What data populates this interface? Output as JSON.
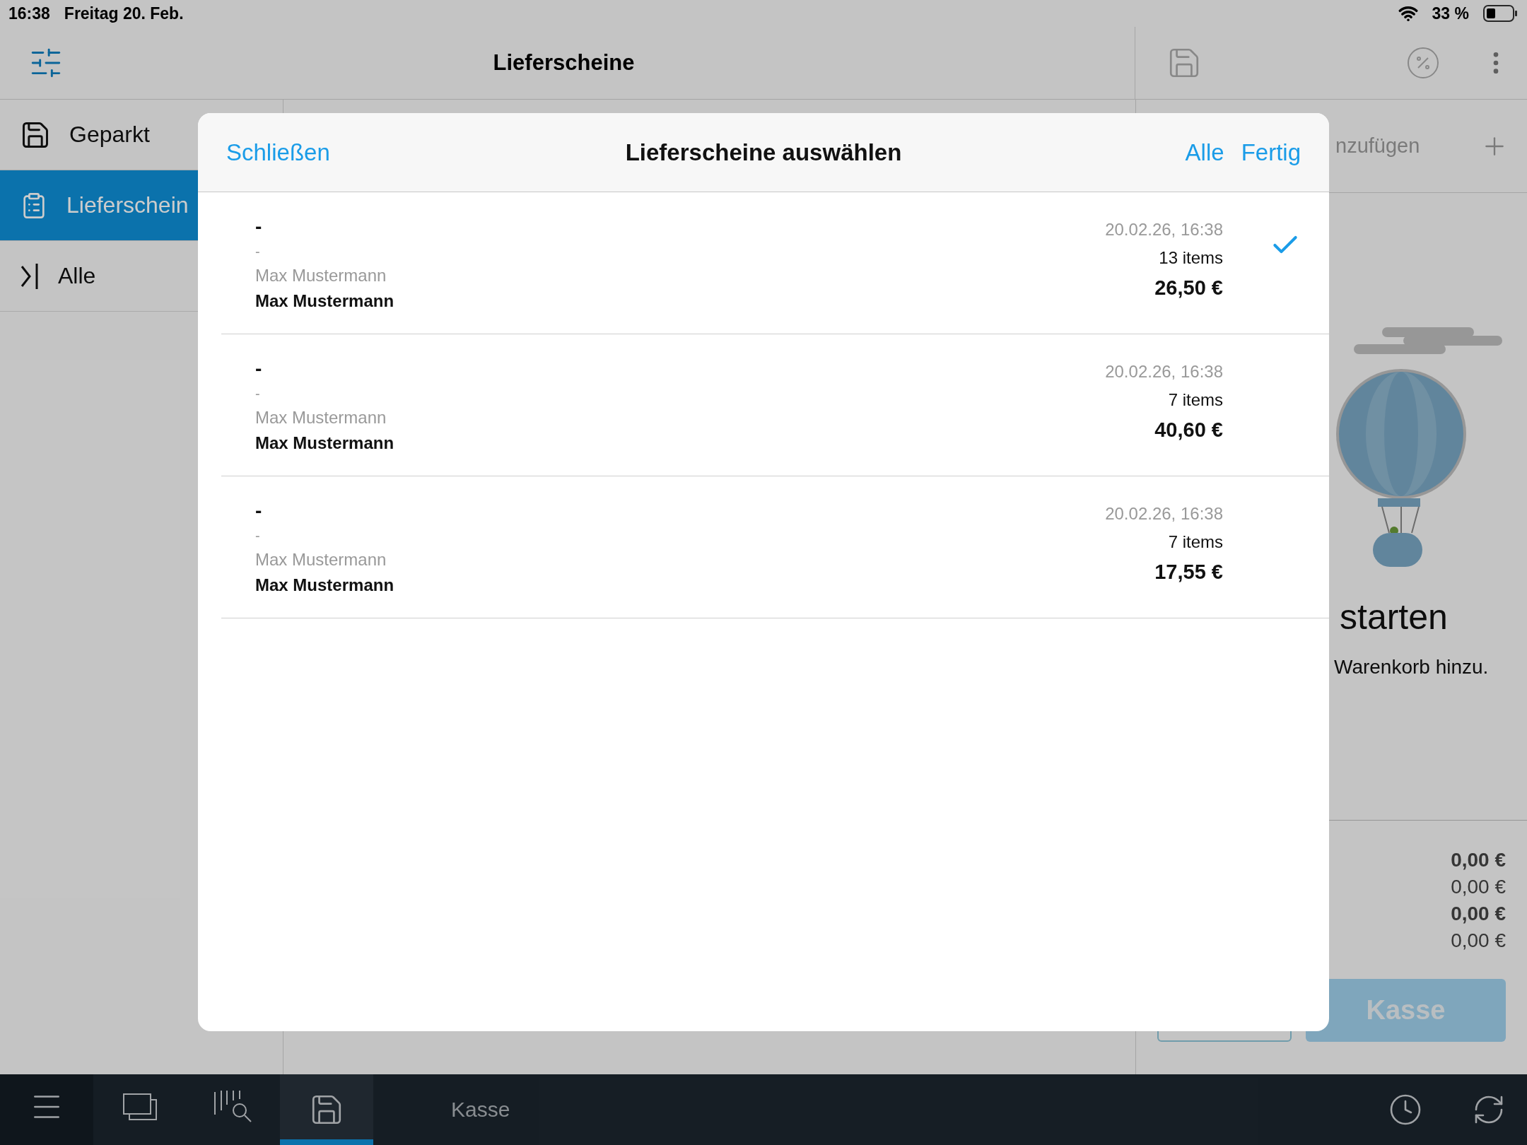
{
  "status_bar": {
    "time": "16:38",
    "date": "Freitag 20. Feb.",
    "battery": "33 %"
  },
  "header": {
    "title": "Lieferscheine"
  },
  "sidebar": {
    "items": [
      {
        "label": "Geparkt",
        "kind": "parked",
        "selected": false
      },
      {
        "label": "Lieferschein",
        "kind": "delivery",
        "selected": true
      },
      {
        "label": "Alle",
        "kind": "all",
        "selected": false
      }
    ]
  },
  "right_panel": {
    "customer_label": "nzufügen",
    "empty_title": "starten",
    "empty_text": "Warenkorb hinzu.",
    "totals": [
      {
        "amount": "0,00 €",
        "bold": true
      },
      {
        "amount": "0,00 €",
        "bold": false
      },
      {
        "amount": "0,00 €",
        "bold": true
      },
      {
        "amount": "0,00 €",
        "bold": false
      }
    ],
    "checkout_button": "Kasse"
  },
  "dialog": {
    "close": "Schließen",
    "title": "Lieferscheine auswählen",
    "select_all": "Alle",
    "done": "Fertig",
    "rows": [
      {
        "title": "-",
        "subtitle": "-",
        "name": "Max Mustermann",
        "customer": "Max Mustermann",
        "date": "20.02.26, 16:38",
        "count": "13 items",
        "total": "26,50 €",
        "selected": true
      },
      {
        "title": "-",
        "subtitle": "-",
        "name": "Max Mustermann",
        "customer": "Max Mustermann",
        "date": "20.02.26, 16:38",
        "count": "7 items",
        "total": "40,60 €",
        "selected": false
      },
      {
        "title": "-",
        "subtitle": "-",
        "name": "Max Mustermann",
        "customer": "Max Mustermann",
        "date": "20.02.26, 16:38",
        "count": "7 items",
        "total": "17,55 €",
        "selected": false
      }
    ]
  },
  "bottom_bar": {
    "tabs": [
      {
        "kind": "menu",
        "selected": false
      },
      {
        "kind": "windows",
        "selected": false
      },
      {
        "kind": "search",
        "selected": false
      },
      {
        "kind": "save",
        "selected": true
      }
    ],
    "label": "Kasse"
  }
}
